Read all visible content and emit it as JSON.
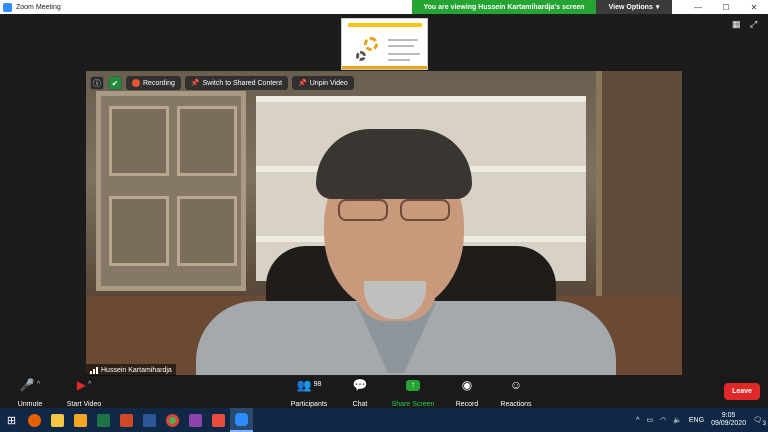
{
  "window": {
    "title": "Zoom Meeting"
  },
  "banner": {
    "viewing_text": "You are viewing Hussein Kartamihardja's screen",
    "view_options": "View Options"
  },
  "video_toolbar": {
    "recording": "Recording",
    "switch": "Switch to Shared Content",
    "unpin": "Unpin Video"
  },
  "speaker": {
    "name": "Hussein Kartamihardja"
  },
  "toolbar": {
    "unmute": "Unmute",
    "start_video": "Start Video",
    "participants": "Participants",
    "participant_count": "98",
    "chat": "Chat",
    "share_screen": "Share Screen",
    "record": "Record",
    "reactions": "Reactions",
    "leave": "Leave"
  },
  "tray": {
    "language": "ENG",
    "time": "9:05",
    "date": "09/09/2020",
    "notif_count": "3"
  },
  "colors": {
    "share_green": "#25a434",
    "leave_red": "#e02828",
    "taskbar": "#102846"
  }
}
